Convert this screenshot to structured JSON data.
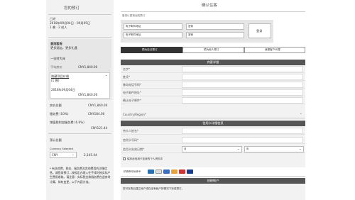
{
  "left": {
    "title": "您的预订",
    "dates_label": "日期",
    "dates": "2018年09月04日 - 09月05日",
    "guests": "1 晚 · 2 成人",
    "hotel_name_1": "皇冠客房",
    "hotel_name_2": "更多酒店，更多礼遇",
    "bed": "一张特大床",
    "avg_label": "平均房价",
    "avg_value": "CNY1,840.00",
    "rate_name_1": "隐藏项目价格",
    "rate_name_2": "(1 晚)",
    "rate_date": "2018年09月04日",
    "rate_value": "CNY1,840.00",
    "room_fee_label": "房价总额",
    "room_fee_value": "CNY1,840.00",
    "service_label": "服务费 (10%)",
    "service_value": "CNY184.00",
    "vat_label": "增值税附加服务费 (6.6%)",
    "vat_value": "CNY121.44",
    "total_label": "预计总额",
    "currency_label": "Currency Selected",
    "currency_value": "CNY",
    "total_value": "2,145.44",
    "note": "* 有关房费、税金、服务费及其他费用的详细信息，请登录预订...按规定办理入住手续时按实际产生费用收取。请注意：实际税金和服务费在退房时计算，如有变更，以下内容为准。"
  },
  "right": {
    "title": "确认住客",
    "login_hint": "登录以更快完成预订",
    "email_placeholder": "电子邮件地址",
    "email2_placeholder": "电子邮件地址",
    "pw_placeholder": "密码",
    "pw2_placeholder": "密码",
    "login_button": "登录",
    "tabs": [
      "预为自己预订",
      "预为他人预订",
      "我是客户代理"
    ],
    "guest_section": "宾客详细",
    "fields": [
      "名字*",
      "姓氏*",
      "移动电话号码*",
      "电子邮件地址*",
      "确认电子邮件*",
      "Country/Region*"
    ],
    "card_section": "信用卡详细信息",
    "card_fields": [
      "持卡人姓名*",
      "信用卡号码*",
      "信用卡失效日期*"
    ],
    "month_placeholder": "月",
    "year_placeholder": "年",
    "save_card": "保存此信用卡至我的个人资料中",
    "accepted_cards": "可接受的信用卡",
    "create_section": "创建帐户",
    "create_text": "您可在购后建立帐户或在没有帐户的情况下完成预订。"
  }
}
